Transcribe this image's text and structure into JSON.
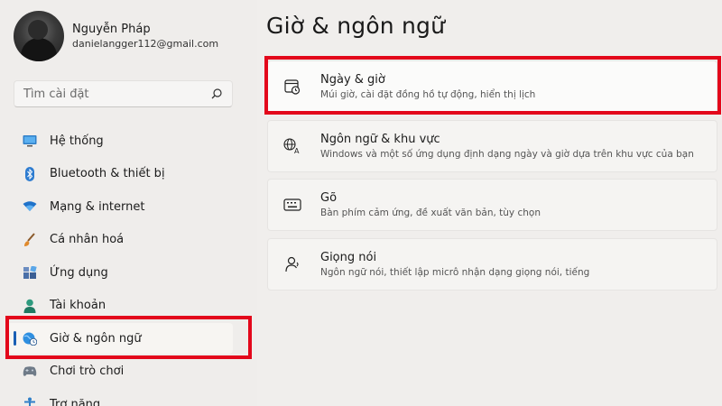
{
  "user": {
    "name": "Nguyễn Pháp",
    "email": "danielangger112@gmail.com"
  },
  "search": {
    "placeholder": "Tìm cài đặt"
  },
  "sidebar": {
    "items": [
      {
        "label": "Hệ thống",
        "icon": "monitor-icon"
      },
      {
        "label": "Bluetooth & thiết bị",
        "icon": "bluetooth-icon"
      },
      {
        "label": "Mạng & internet",
        "icon": "wifi-icon"
      },
      {
        "label": "Cá nhân hoá",
        "icon": "brush-icon"
      },
      {
        "label": "Ứng dụng",
        "icon": "apps-icon"
      },
      {
        "label": "Tài khoản",
        "icon": "person-icon"
      },
      {
        "label": "Giờ & ngôn ngữ",
        "icon": "globe-clock-icon"
      },
      {
        "label": "Chơi trò chơi",
        "icon": "gamepad-icon"
      },
      {
        "label": "Trợ năng",
        "icon": "accessibility-icon"
      }
    ],
    "active_index": 6
  },
  "main": {
    "title": "Giờ & ngôn ngữ",
    "cards": [
      {
        "title": "Ngày & giờ",
        "desc": "Múi giờ, cài đặt đồng hồ tự động, hiển thị lịch",
        "icon": "calendar-clock-icon"
      },
      {
        "title": "Ngôn ngữ & khu vực",
        "desc": "Windows và một số ứng dụng định dạng ngày và giờ dựa trên khu vực của bạn",
        "icon": "language-icon"
      },
      {
        "title": "Gõ",
        "desc": "Bàn phím cảm ứng, đề xuất văn bản, tùy chọn",
        "icon": "keyboard-icon"
      },
      {
        "title": "Giọng nói",
        "desc": "Ngôn ngữ nói, thiết lập micrô nhận dạng giọng nói, tiếng",
        "icon": "speech-icon"
      }
    ]
  },
  "colors": {
    "accent": "#1a5fb4",
    "highlight_border": "#e3071b"
  }
}
